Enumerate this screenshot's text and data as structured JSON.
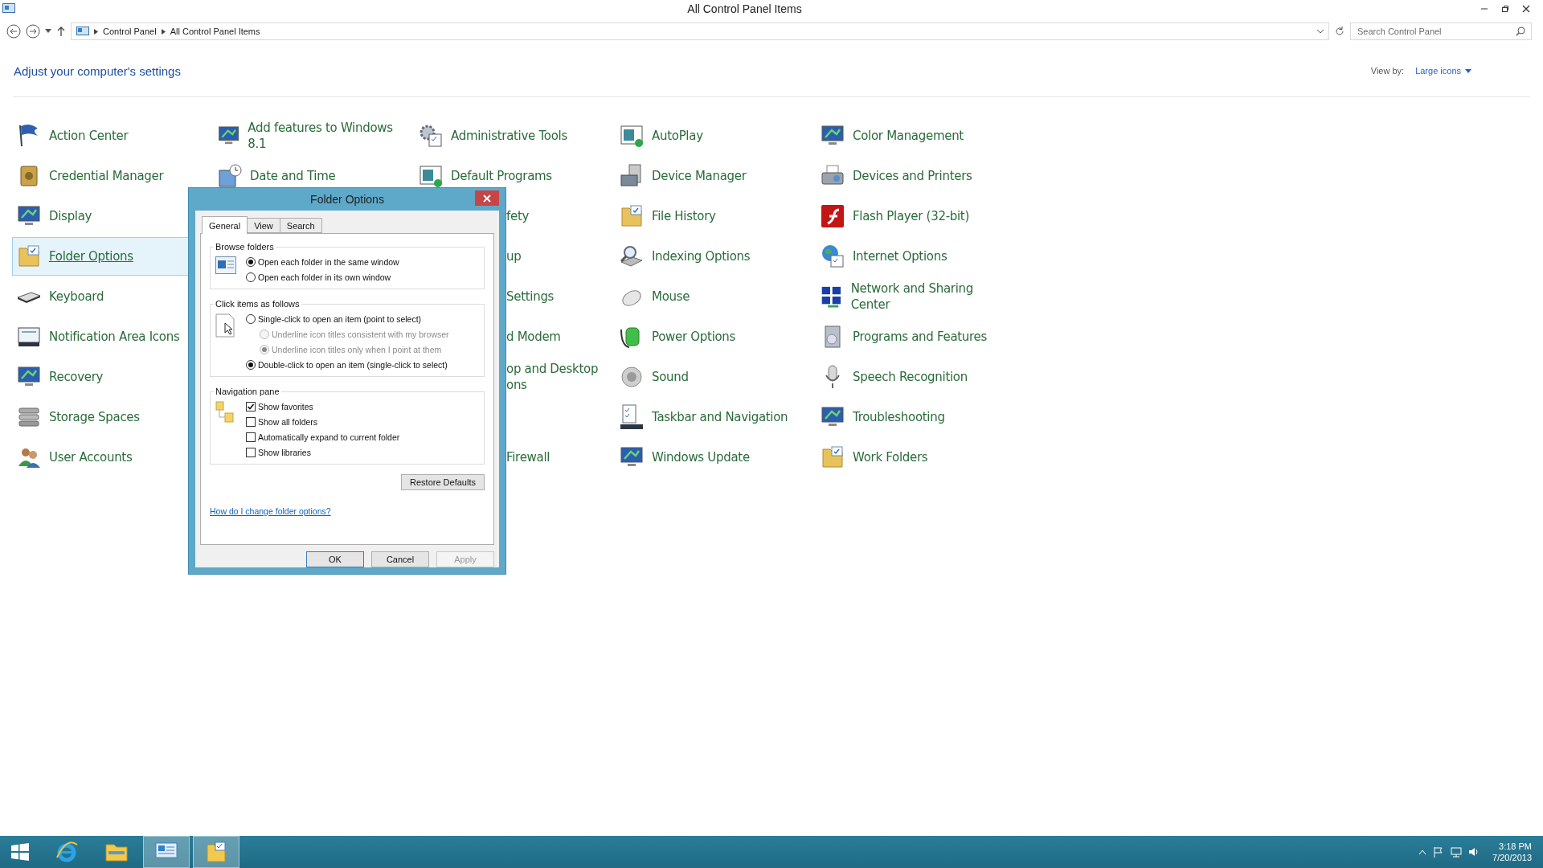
{
  "window": {
    "title": "All Control Panel Items"
  },
  "address": {
    "crumbs": [
      "Control Panel",
      "All Control Panel Items"
    ],
    "search_placeholder": "Search Control Panel"
  },
  "header": {
    "title": "Adjust your computer's settings",
    "view_by_label": "View by:",
    "view_by_value": "Large icons"
  },
  "columns": [
    {
      "items": [
        {
          "kind": "item",
          "label": "Action Center",
          "selected": false
        },
        {
          "kind": "item",
          "label": "Credential Manager",
          "selected": false
        },
        {
          "kind": "item",
          "label": "Display",
          "selected": false
        },
        {
          "kind": "item",
          "label": "Folder Options",
          "selected": true
        },
        {
          "kind": "item",
          "label": "Keyboard",
          "selected": false
        },
        {
          "kind": "item",
          "label": "Notification Area Icons",
          "selected": false
        },
        {
          "kind": "item",
          "label": "Recovery",
          "selected": false
        },
        {
          "kind": "item",
          "label": "Storage Spaces",
          "selected": false
        },
        {
          "kind": "item",
          "label": "User Accounts",
          "selected": false
        }
      ]
    },
    {
      "items": [
        {
          "kind": "item",
          "label": "Add features to Windows 8.1",
          "selected": false
        },
        {
          "kind": "item",
          "label": "Date and Time",
          "selected": false
        }
      ]
    },
    {
      "items": [
        {
          "kind": "item",
          "label": "Administrative Tools",
          "selected": false
        },
        {
          "kind": "item",
          "label": "Default Programs",
          "selected": false
        },
        {
          "kind": "partial",
          "label": "fety",
          "selected": false
        },
        {
          "kind": "partial",
          "label": "up",
          "selected": false
        },
        {
          "kind": "partial",
          "label": "Settings",
          "selected": false
        },
        {
          "kind": "partial",
          "label": "d Modem",
          "selected": false
        },
        {
          "kind": "partial",
          "label": "op and Desktop\nons",
          "selected": false
        },
        {
          "kind": "blank"
        },
        {
          "kind": "partial",
          "label": "Firewall",
          "selected": false
        }
      ]
    },
    {
      "items": [
        {
          "kind": "item",
          "label": "AutoPlay",
          "selected": false
        },
        {
          "kind": "item",
          "label": "Device Manager",
          "selected": false
        },
        {
          "kind": "item",
          "label": "File History",
          "selected": false
        },
        {
          "kind": "item",
          "label": "Indexing Options",
          "selected": false
        },
        {
          "kind": "item",
          "label": "Mouse",
          "selected": false
        },
        {
          "kind": "item",
          "label": "Power Options",
          "selected": false
        },
        {
          "kind": "item",
          "label": "Sound",
          "selected": false
        },
        {
          "kind": "item",
          "label": "Taskbar and Navigation",
          "selected": false
        },
        {
          "kind": "item",
          "label": "Windows Update",
          "selected": false
        }
      ]
    },
    {
      "items": [
        {
          "kind": "item",
          "label": "Color Management",
          "selected": false
        },
        {
          "kind": "item",
          "label": "Devices and Printers",
          "selected": false
        },
        {
          "kind": "item",
          "label": "Flash Player (32-bit)",
          "selected": false
        },
        {
          "kind": "item",
          "label": "Internet Options",
          "selected": false
        },
        {
          "kind": "item",
          "label": "Network and Sharing Center",
          "selected": false
        },
        {
          "kind": "item",
          "label": "Programs and Features",
          "selected": false
        },
        {
          "kind": "item",
          "label": "Speech Recognition",
          "selected": false
        },
        {
          "kind": "item",
          "label": "Troubleshooting",
          "selected": false
        },
        {
          "kind": "item",
          "label": "Work Folders",
          "selected": false
        }
      ]
    }
  ],
  "dialog": {
    "title": "Folder Options",
    "tabs": [
      {
        "label": "General",
        "selected": true
      },
      {
        "label": "View",
        "selected": false
      },
      {
        "label": "Search",
        "selected": false
      }
    ],
    "groups": [
      {
        "title": "Browse folders",
        "options": [
          {
            "kind": "radio",
            "label": "Open each folder in the same window",
            "checked": true,
            "disabled": false
          },
          {
            "kind": "radio",
            "label": "Open each folder in its own window",
            "checked": false,
            "disabled": false
          }
        ]
      },
      {
        "title": "Click items as follows",
        "options": [
          {
            "kind": "radio",
            "label": "Single-click to open an item (point to select)",
            "checked": false,
            "disabled": false,
            "children": [
              {
                "kind": "radio",
                "label": "Underline icon titles consistent with my browser",
                "checked": false,
                "disabled": true
              },
              {
                "kind": "radio",
                "label": "Underline icon titles only when I point at them",
                "checked": true,
                "disabled": true
              }
            ]
          },
          {
            "kind": "radio",
            "label": "Double-click to open an item (single-click to select)",
            "checked": true,
            "disabled": false
          }
        ]
      },
      {
        "title": "Navigation pane",
        "options": [
          {
            "kind": "checkbox",
            "label": "Show favorites",
            "checked": true,
            "disabled": false
          },
          {
            "kind": "checkbox",
            "label": "Show all folders",
            "checked": false,
            "disabled": false
          },
          {
            "kind": "checkbox",
            "label": "Automatically expand to current folder",
            "checked": false,
            "disabled": false
          },
          {
            "kind": "checkbox",
            "label": "Show libraries",
            "checked": false,
            "disabled": false
          }
        ]
      }
    ],
    "restore_button": "Restore Defaults",
    "help_link": "How do I change folder options?",
    "buttons": [
      {
        "label": "OK",
        "default": true,
        "disabled": false
      },
      {
        "label": "Cancel",
        "default": false,
        "disabled": false
      },
      {
        "label": "Apply",
        "default": false,
        "disabled": true
      }
    ]
  },
  "taskbar": {
    "apps": [
      {
        "selected": false
      },
      {
        "selected": false
      },
      {
        "selected": true
      },
      {
        "selected": true
      }
    ],
    "time": "3:18 PM",
    "date": "7/20/2013"
  }
}
